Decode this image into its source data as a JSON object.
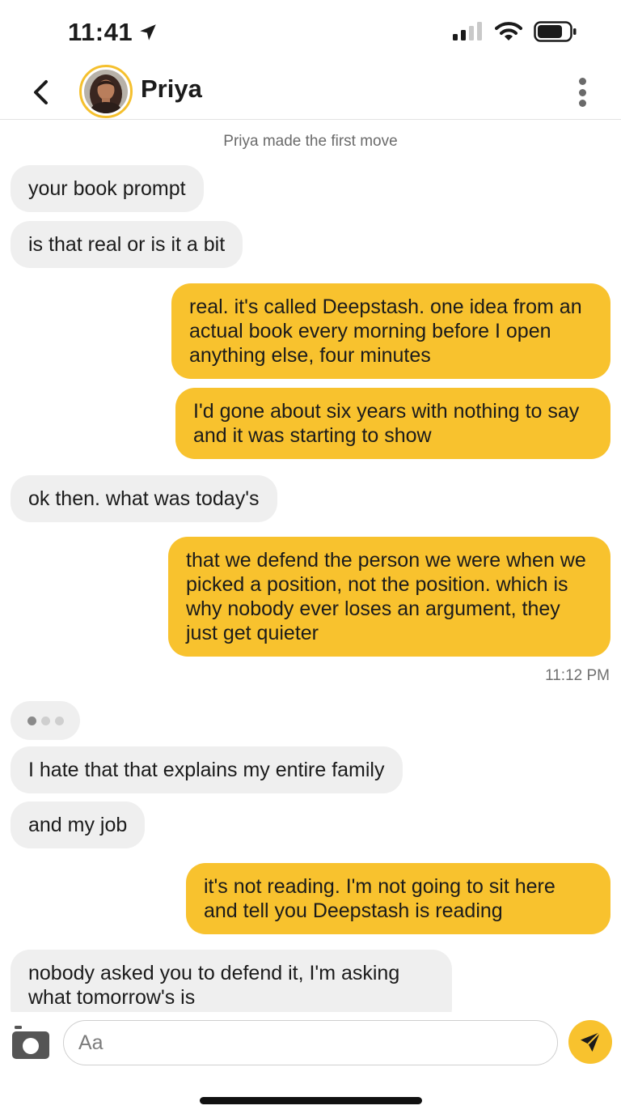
{
  "status_bar": {
    "time": "11:41",
    "icons": [
      "location-arrow-icon",
      "cellular-signal-icon",
      "wifi-icon",
      "battery-icon"
    ]
  },
  "header": {
    "contact_name": "Priya",
    "icons": [
      "back-chevron-icon",
      "more-vertical-icon"
    ]
  },
  "chat": {
    "system_note": "Priya made the first move",
    "messages": [
      {
        "from": "them",
        "text": "your book prompt"
      },
      {
        "from": "them",
        "text": "is that real or is it a bit"
      },
      {
        "from": "me",
        "text": "real. it's called Deepstash. one idea from an actual book every morning before I open anything else, four minutes"
      },
      {
        "from": "me",
        "text": "I'd gone about six years with nothing to say and it was starting to show"
      },
      {
        "from": "them",
        "text": "ok then. what was today's"
      },
      {
        "from": "me",
        "text": "that we defend the person we were when we picked a position, not the position. which is why nobody ever loses an argument, they just get quieter"
      },
      {
        "from": "them",
        "text": "I hate that that explains my entire family"
      },
      {
        "from": "them",
        "text": "and my job"
      },
      {
        "from": "me",
        "text": "it's not reading. I'm not going to sit here and tell you Deepstash is reading"
      },
      {
        "from": "them",
        "text": "nobody asked you to defend it, I'm asking what tomorrow's is"
      }
    ],
    "timestamp": "11:12 PM"
  },
  "composer": {
    "placeholder": "Aa",
    "value": ""
  },
  "colors": {
    "accent": "#f8c22e",
    "incoming_bubble": "#efefef",
    "avatar_ring": "#f5c02e"
  }
}
